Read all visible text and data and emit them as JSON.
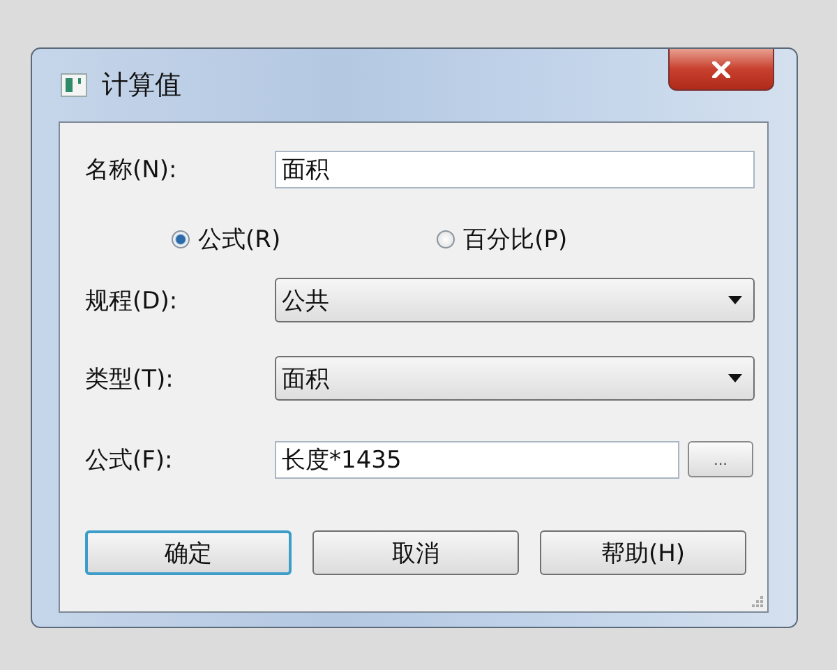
{
  "window": {
    "title": "计算值"
  },
  "rows": [
    {
      "kind": "text",
      "label": "名称(N):",
      "value": "面积"
    },
    {
      "kind": "radios",
      "options": [
        {
          "label": "公式(R)",
          "selected": true
        },
        {
          "label": "百分比(P)",
          "selected": false
        }
      ]
    },
    {
      "kind": "dropdown",
      "label": "规程(D):",
      "value": "公共"
    },
    {
      "kind": "dropdown",
      "label": "类型(T):",
      "value": "面积"
    },
    {
      "kind": "formula",
      "label": "公式(F):",
      "value": "长度*1435",
      "button": "..."
    }
  ],
  "buttons": [
    {
      "label": "确定",
      "default": true
    },
    {
      "label": "取消",
      "default": false
    },
    {
      "label": "帮助(H)",
      "default": false
    }
  ]
}
